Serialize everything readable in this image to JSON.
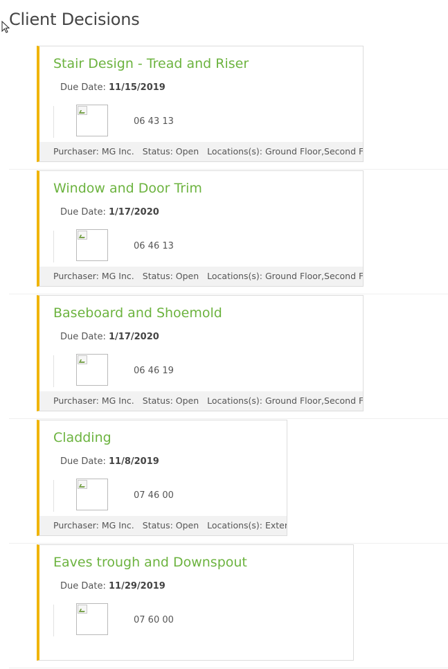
{
  "page": {
    "title": "Client Decisions"
  },
  "colors": {
    "accent": "#f0b400",
    "title_green": "#6cb33f",
    "meta_bg": "#f2f2f2"
  },
  "cards": [
    {
      "title": "Stair Design - Tread and Riser",
      "due_label": "Due Date:",
      "due_date": "11/15/2019",
      "code": "06 43 13",
      "purchaser": "Purchaser: MG Inc.",
      "status": "Status: Open",
      "locations": "Locations(s): Ground Floor,Second Floor"
    },
    {
      "title": "Window and Door Trim",
      "due_label": "Due Date:",
      "due_date": "1/17/2020",
      "code": "06 46 13",
      "purchaser": "Purchaser: MG Inc.",
      "status": "Status: Open",
      "locations": "Locations(s): Ground Floor,Second Floor"
    },
    {
      "title": "Baseboard and Shoemold",
      "due_label": "Due Date:",
      "due_date": "1/17/2020",
      "code": "06 46 19",
      "purchaser": "Purchaser: MG Inc.",
      "status": "Status: Open",
      "locations": "Locations(s): Ground Floor,Second Floor"
    },
    {
      "title": "Cladding",
      "due_label": "Due Date:",
      "due_date": "11/8/2019",
      "code": "07 46 00",
      "purchaser": "Purchaser: MG Inc.",
      "status": "Status: Open",
      "locations": "Locations(s): Exterior"
    },
    {
      "title": "Eaves trough and Downspout",
      "due_label": "Due Date:",
      "due_date": "11/29/2019",
      "code": "07 60 00",
      "purchaser": "",
      "status": "",
      "locations": ""
    }
  ]
}
